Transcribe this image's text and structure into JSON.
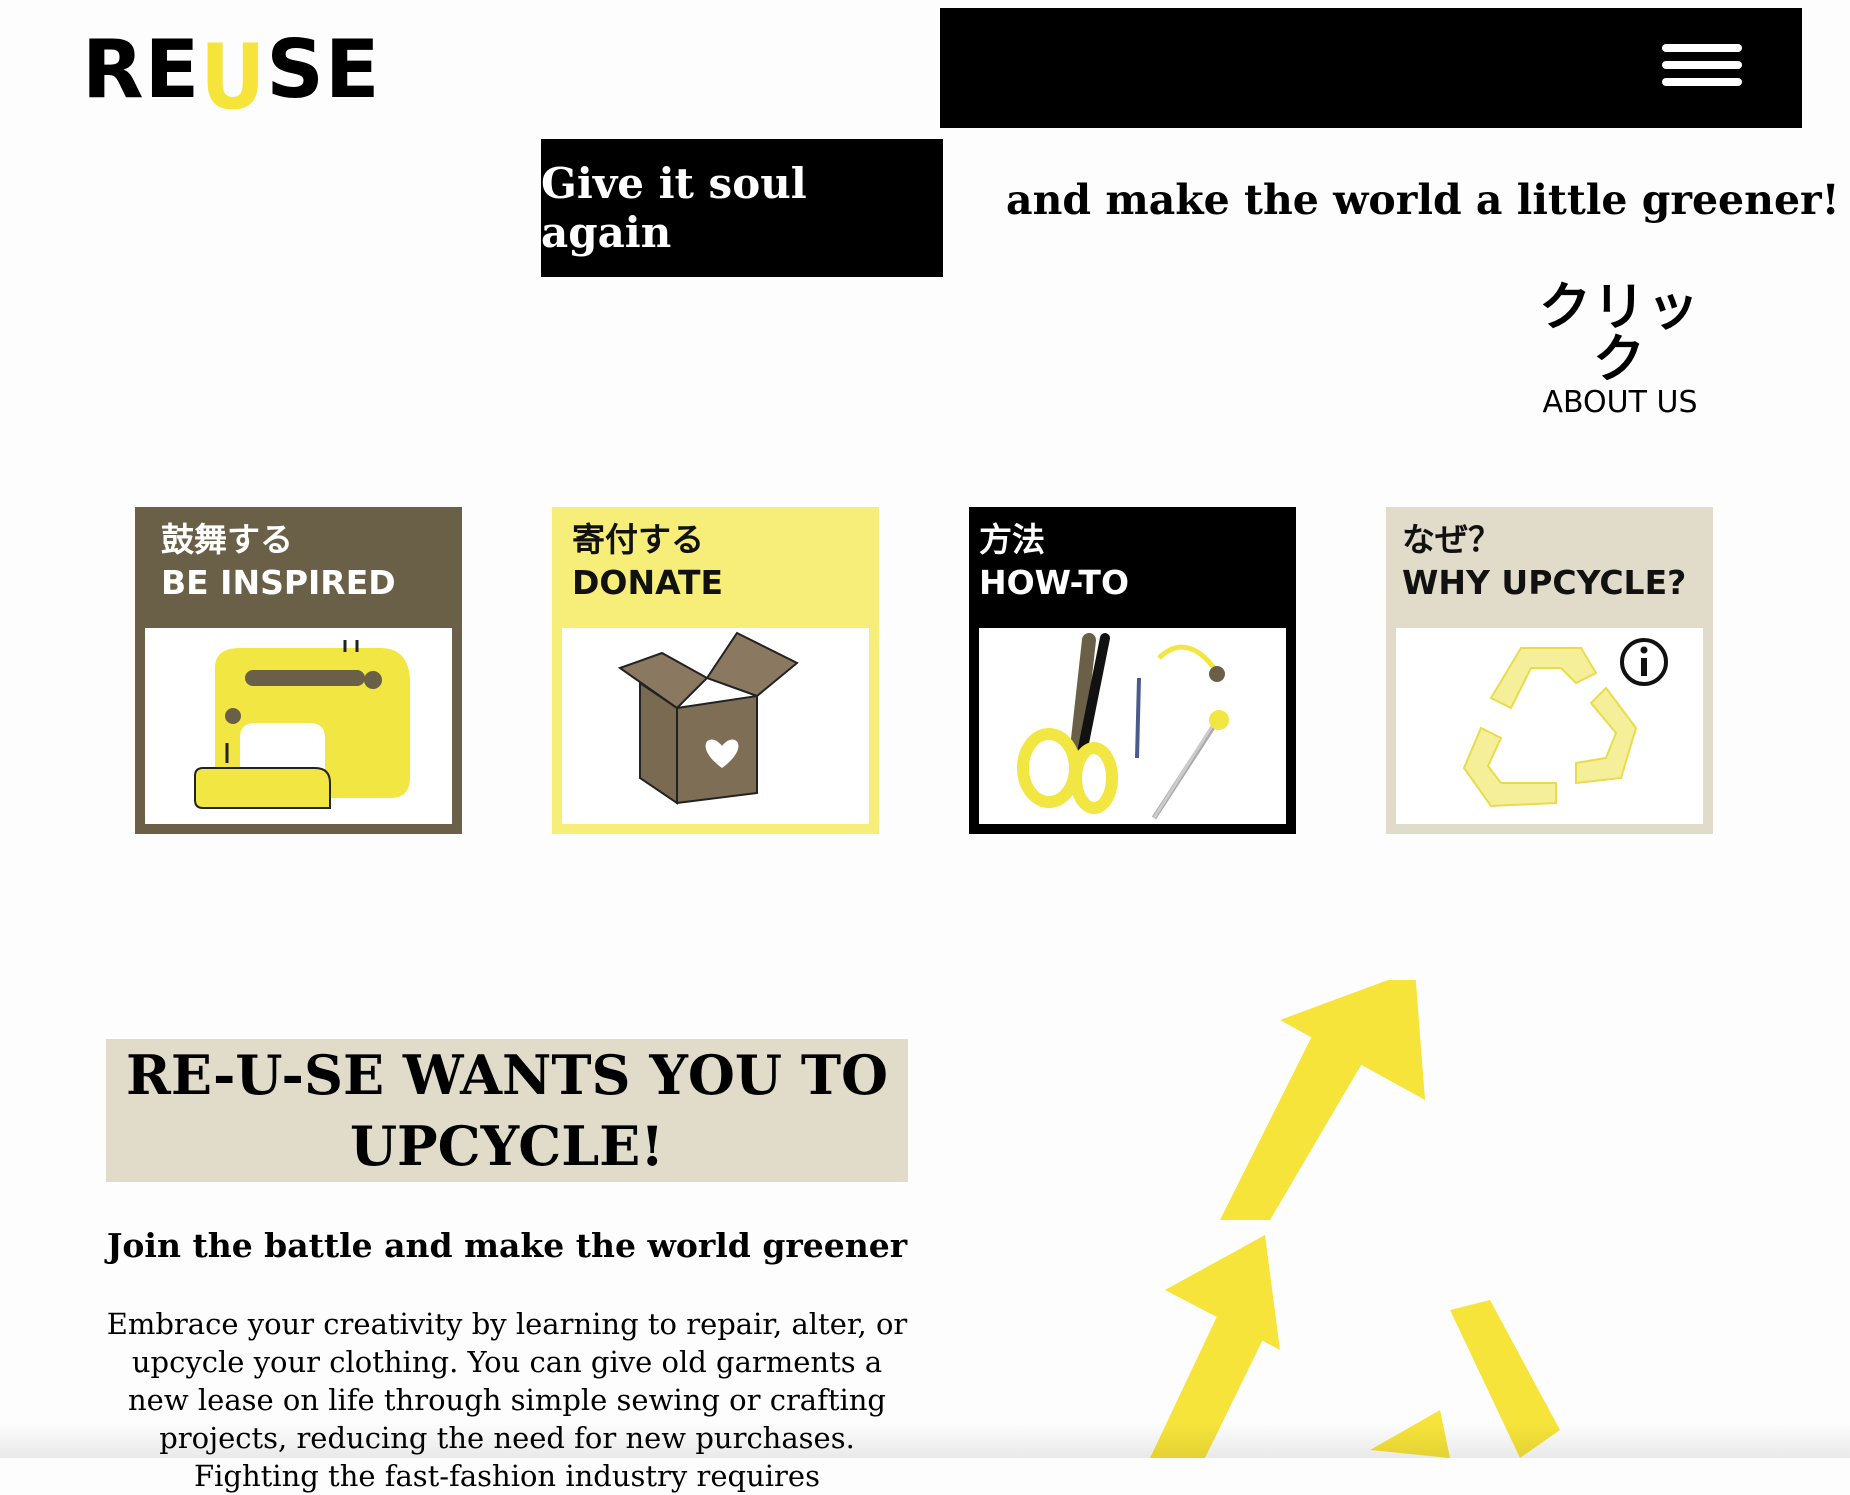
{
  "logo": {
    "part1": "RE",
    "part2": "U",
    "part3": "SE"
  },
  "header": {
    "menu_icon": "hamburger-icon"
  },
  "tagline": {
    "highlight": "Give it soul again",
    "rest": "and make the world a little greener!"
  },
  "about": {
    "jp": "クリック",
    "en": "ABOUT US"
  },
  "cards": [
    {
      "jp": "鼓舞する",
      "en": "BE INSPIRED",
      "icon": "sewing-machine-icon"
    },
    {
      "jp": "寄付する",
      "en": "DONATE",
      "icon": "box-heart-icon"
    },
    {
      "jp": "方法",
      "en": "HOW-TO",
      "icon": "scissors-icon"
    },
    {
      "jp": "なぜ？",
      "en": "WHY UPCYCLE?",
      "icon": "recycle-icon",
      "badge_icon": "info-icon"
    }
  ],
  "banner": {
    "title": "RE-U-SE WANTS YOU TO UPCYCLE!"
  },
  "subheading": "Join the battle and make the world greener",
  "paragraph": "Embrace your creativity by learning to repair, alter, or upcycle your clothing. You can give old garments a new lease on life through simple sewing or crafting projects, reducing the need for new purchases. Fighting the fast-fashion industry requires",
  "colors": {
    "accent_yellow": "#f7e43a",
    "card_brown": "#6a5f47",
    "card_yellow": "#f6ee78",
    "card_beige": "#e0dcc9",
    "black": "#000000"
  }
}
